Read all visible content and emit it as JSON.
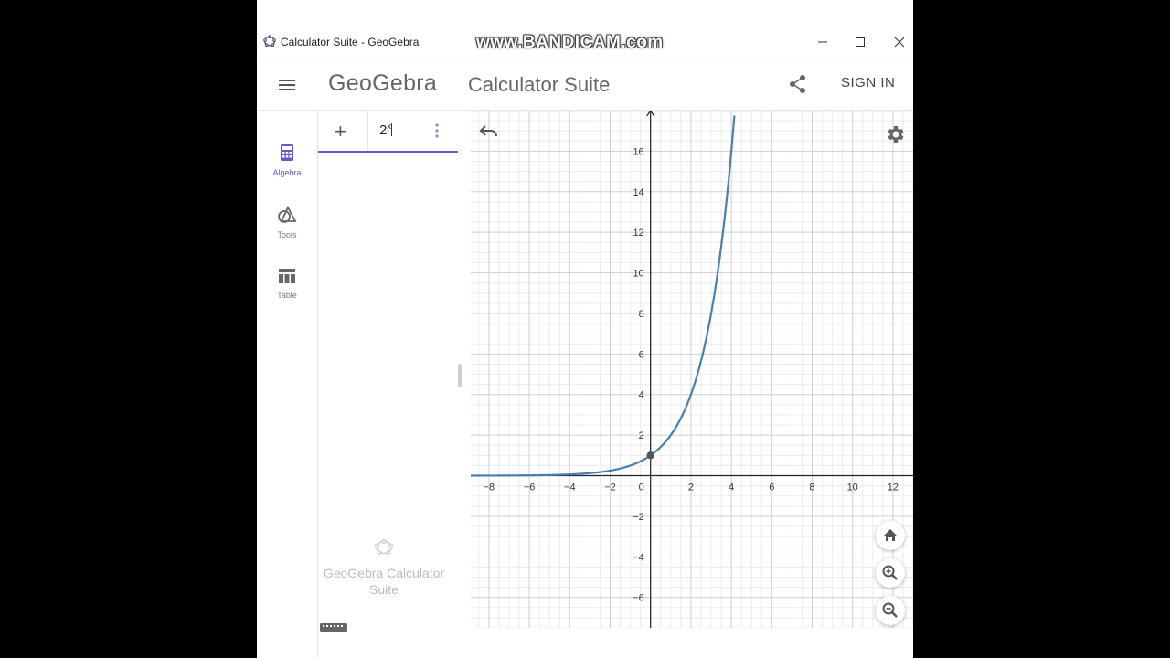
{
  "window": {
    "title": "Calculator Suite - GeoGebra",
    "controls": [
      "minimize",
      "maximize",
      "close"
    ]
  },
  "watermark": "www.BANDICAM.com",
  "header": {
    "logo": "GeoGebra",
    "title": "Calculator Suite",
    "share_icon": "share-icon",
    "signin_label": "SIGN IN"
  },
  "rail": {
    "items": [
      {
        "label": "Algebra",
        "icon": "calculator-icon",
        "active": true
      },
      {
        "label": "Tools",
        "icon": "tools-icon",
        "active": false
      },
      {
        "label": "Table",
        "icon": "table-icon",
        "active": false
      }
    ]
  },
  "algebra": {
    "input_base": "2",
    "input_exponent": "x",
    "footer_text": "GeoGebra Calculator Suite"
  },
  "graph": {
    "function": "2^x",
    "x_ticks": [
      "-8",
      "-6",
      "-4",
      "-2",
      "0",
      "2",
      "4",
      "6",
      "8",
      "10",
      "12"
    ],
    "y_ticks": [
      "-6",
      "-4",
      "-2",
      "2",
      "4",
      "6",
      "8",
      "10",
      "12",
      "14",
      "16"
    ],
    "xlim": [
      -8.9,
      13
    ],
    "ylim": [
      -7.5,
      18
    ],
    "point": {
      "x": 0,
      "y": 1
    },
    "colors": {
      "curve": "#4a7fad",
      "point": "#555555",
      "accent": "#6557d2"
    }
  }
}
